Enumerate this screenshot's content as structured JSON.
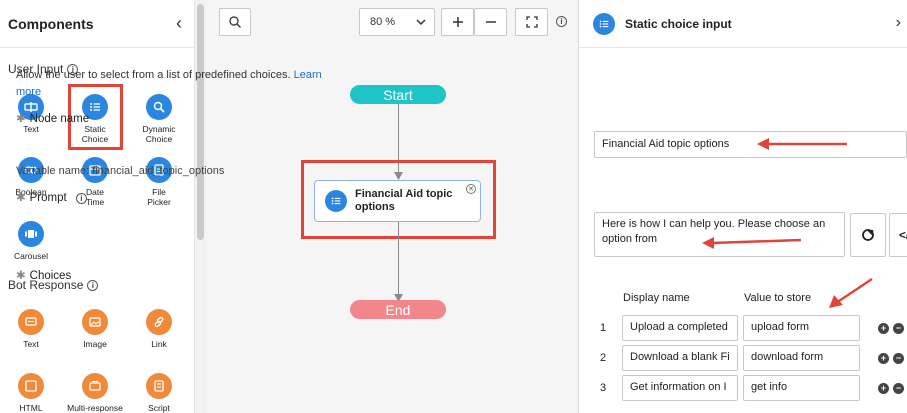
{
  "left_panel": {
    "title": "Components",
    "user_input": {
      "title": "User Input",
      "items": [
        "Text",
        "Static Choice",
        "Dynamic Choice",
        "Boolean",
        "Date Time",
        "File Picker",
        "Carousel"
      ]
    },
    "bot_response": {
      "title": "Bot Response",
      "items": [
        "Text",
        "Image",
        "Link",
        "HTML",
        "Multi-response",
        "Script"
      ]
    }
  },
  "canvas": {
    "zoom": "80 %",
    "start_label": "Start",
    "end_label": "End",
    "node_label_line1": "Financial Aid topic",
    "node_label_line2": "options"
  },
  "right_panel": {
    "title": "Static choice input",
    "description": "Allow the user to select from a list of predefined choices.",
    "learn_more_line1": "Learn",
    "learn_more_line2": "more",
    "node_name_label": "Node name",
    "node_name_value": "Financial Aid topic options",
    "variable_name": "Variable name: financial_aid_topic_options",
    "prompt_label": "Prompt",
    "prompt_line1": "Here is how I can help you. Please choose an",
    "prompt_line2": "option from",
    "code_button": "</",
    "choices_label": "Choices",
    "col_display": "Display name",
    "col_value": "Value to store",
    "choices": [
      {
        "num": "1",
        "display": "Upload a completed",
        "value": "upload form"
      },
      {
        "num": "2",
        "display": "Download a blank Fi",
        "value": "download form"
      },
      {
        "num": "3",
        "display": "Get information on I",
        "value": "get info"
      }
    ]
  },
  "colors": {
    "accent_blue": "#2a86e0",
    "start_teal": "#1fc4c9",
    "end_red": "#f2868a",
    "highlight_red": "#e0453b",
    "orange": "#f08a3a"
  }
}
